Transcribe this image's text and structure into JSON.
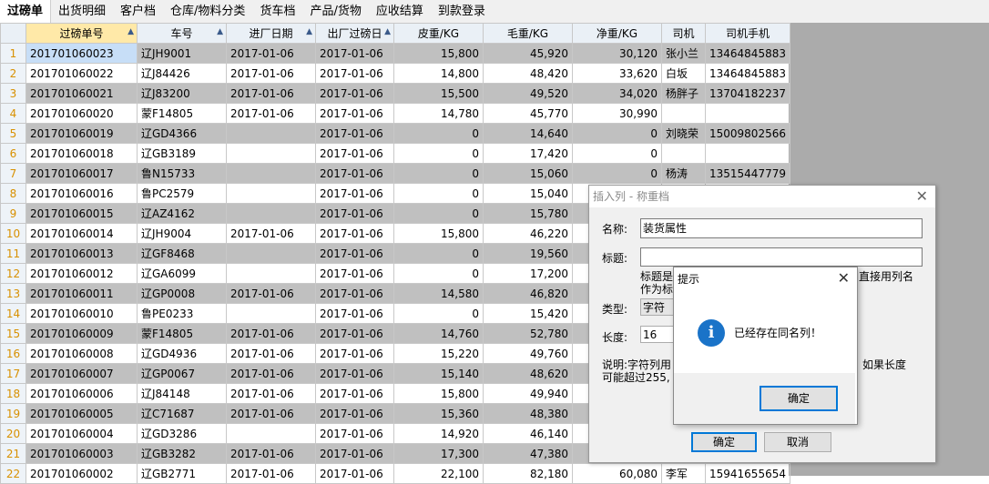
{
  "tabs": [
    "过磅单",
    "出货明细",
    "客户档",
    "仓库/物料分类",
    "货车档",
    "产品/货物",
    "应收结算",
    "到款登录"
  ],
  "grid": {
    "columns": [
      "过磅单号",
      "车号",
      "进厂日期",
      "出厂过磅日",
      "皮重/KG",
      "毛重/KG",
      "净重/KG",
      "司机",
      "司机手机"
    ],
    "rows": [
      [
        "1",
        "201701060023",
        "辽JH9001",
        "2017-01-06",
        "2017-01-06",
        "15,800",
        "45,920",
        "30,120",
        "张小兰",
        "13464845883"
      ],
      [
        "2",
        "201701060022",
        "辽J84426",
        "2017-01-06",
        "2017-01-06",
        "14,800",
        "48,420",
        "33,620",
        "白坂",
        "13464845883"
      ],
      [
        "3",
        "201701060021",
        "辽J83200",
        "2017-01-06",
        "2017-01-06",
        "15,500",
        "49,520",
        "34,020",
        "杨胖子",
        "13704182237"
      ],
      [
        "4",
        "201701060020",
        "蒙F14805",
        "2017-01-06",
        "2017-01-06",
        "14,780",
        "45,770",
        "30,990",
        "",
        ""
      ],
      [
        "5",
        "201701060019",
        "辽GD4366",
        "",
        "2017-01-06",
        "0",
        "14,640",
        "0",
        "刘晓荣",
        "15009802566"
      ],
      [
        "6",
        "201701060018",
        "辽GB3189",
        "",
        "2017-01-06",
        "0",
        "17,420",
        "0",
        "",
        ""
      ],
      [
        "7",
        "201701060017",
        "鲁N15733",
        "",
        "2017-01-06",
        "0",
        "15,060",
        "0",
        "杨涛",
        "13515447779"
      ],
      [
        "8",
        "201701060016",
        "鲁PC2579",
        "",
        "2017-01-06",
        "0",
        "15,040",
        "",
        "",
        ""
      ],
      [
        "9",
        "201701060015",
        "辽AZ4162",
        "",
        "2017-01-06",
        "0",
        "15,780",
        "",
        "",
        ""
      ],
      [
        "10",
        "201701060014",
        "辽JH9004",
        "2017-01-06",
        "2017-01-06",
        "15,800",
        "46,220",
        "",
        "",
        ""
      ],
      [
        "11",
        "201701060013",
        "辽GF8468",
        "",
        "2017-01-06",
        "0",
        "19,560",
        "",
        "",
        ""
      ],
      [
        "12",
        "201701060012",
        "辽GA6099",
        "",
        "2017-01-06",
        "0",
        "17,200",
        "",
        "",
        ""
      ],
      [
        "13",
        "201701060011",
        "辽GP0008",
        "2017-01-06",
        "2017-01-06",
        "14,580",
        "46,820",
        "",
        "",
        ""
      ],
      [
        "14",
        "201701060010",
        "鲁PE0233",
        "",
        "2017-01-06",
        "0",
        "15,420",
        "",
        "",
        ""
      ],
      [
        "15",
        "201701060009",
        "蒙F14805",
        "2017-01-06",
        "2017-01-06",
        "14,760",
        "52,780",
        "",
        "",
        ""
      ],
      [
        "16",
        "201701060008",
        "辽GD4936",
        "2017-01-06",
        "2017-01-06",
        "15,220",
        "49,760",
        "",
        "",
        ""
      ],
      [
        "17",
        "201701060007",
        "辽GP0067",
        "2017-01-06",
        "2017-01-06",
        "15,140",
        "48,620",
        "",
        "",
        ""
      ],
      [
        "18",
        "201701060006",
        "辽J84148",
        "2017-01-06",
        "2017-01-06",
        "15,800",
        "49,940",
        "",
        "",
        ""
      ],
      [
        "19",
        "201701060005",
        "辽C71687",
        "2017-01-06",
        "2017-01-06",
        "15,360",
        "48,380",
        "",
        "",
        ""
      ],
      [
        "20",
        "201701060004",
        "辽GD3286",
        "",
        "2017-01-06",
        "14,920",
        "46,140",
        "",
        "",
        ""
      ],
      [
        "21",
        "201701060003",
        "辽GB3282",
        "2017-01-06",
        "2017-01-06",
        "17,300",
        "47,380",
        "",
        "",
        ""
      ],
      [
        "22",
        "201701060002",
        "辽GB2771",
        "2017-01-06",
        "2017-01-06",
        "22,100",
        "82,180",
        "60,080",
        "李军",
        "15941655654"
      ]
    ]
  },
  "insert_dialog": {
    "title": "插入列 - 称重档",
    "name_label": "名称:",
    "name_value": "装货属性",
    "caption_label": "标题:",
    "caption_value": "",
    "caption_hint_1": "标题是",
    "caption_hint_1b": "直接用列名",
    "caption_hint_2": "作为标",
    "type_label": "类型:",
    "type_value": "字符",
    "length_label": "长度:",
    "length_value": "16",
    "note_1": "说明:字符列用",
    "note_1b": "如果长度",
    "note_2": "可能超过255,",
    "ok_label": "确定",
    "cancel_label": "取消"
  },
  "message_box": {
    "title": "提示",
    "text": "已经存在同名列！",
    "ok_label": "确定",
    "icon": "info-icon"
  }
}
